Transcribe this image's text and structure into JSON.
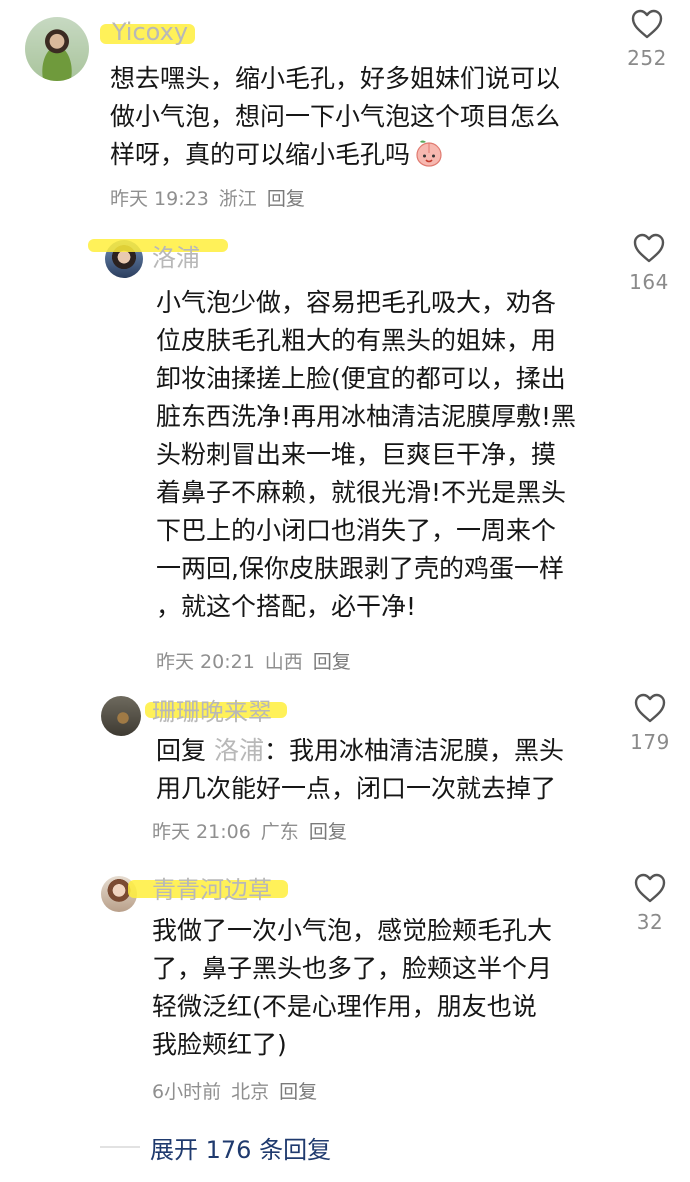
{
  "comments": [
    {
      "author": "Yicoxy",
      "lines": [
        "想去嘿头，缩小毛孔，好多姐妹们说可以",
        "做小气泡，想问一下小气泡这个项目怎么",
        "样呀，真的可以缩小毛孔吗"
      ],
      "emoji": "peach-face-icon",
      "time": "昨天 19:23",
      "location": "浙江",
      "reply_label": "回复",
      "likes": "252"
    },
    {
      "author": "洛浦",
      "lines": [
        "小气泡少做，容易把毛孔吸大，劝各",
        "位皮肤毛孔粗大的有黑头的姐妹，用",
        "卸妆油揉搓上脸(便宜的都可以，揉出",
        "脏东西洗净!再用冰柚清洁泥膜厚敷!黑",
        "头粉刺冒出来一堆，巨爽巨干净，摸",
        "着鼻子不麻赖，就很光滑!不光是黑头",
        "下巴上的小闭口也消失了，一周来个",
        "一两回,保你皮肤跟剥了壳的鸡蛋一样",
        "，就这个搭配，必干净!"
      ],
      "time": "昨天 20:21",
      "location": "山西",
      "reply_label": "回复",
      "likes": "164"
    },
    {
      "author": "珊珊晚来翠",
      "reply_prefix": "回复",
      "reply_target": "洛浦",
      "lines": [
        "：我用冰柚清洁泥膜，黑头",
        "用几次能好一点，闭口一次就去掉了"
      ],
      "time": "昨天 21:06",
      "location": "广东",
      "reply_label": "回复",
      "likes": "179"
    },
    {
      "author": "青青河边草",
      "lines": [
        "我做了一次小气泡，感觉脸颊毛孔大",
        "了，鼻子黑头也多了，脸颊这半个月",
        "轻微泛红(不是心理作用，朋友也说",
        "我脸颊红了)"
      ],
      "time": "6小时前",
      "location": "北京",
      "reply_label": "回复",
      "likes": "32"
    }
  ],
  "expand_replies": "展开 176 条回复",
  "colors": {
    "highlight": "#ffee3c",
    "link": "#1f3a6e",
    "meta": "#8f8f8f"
  }
}
